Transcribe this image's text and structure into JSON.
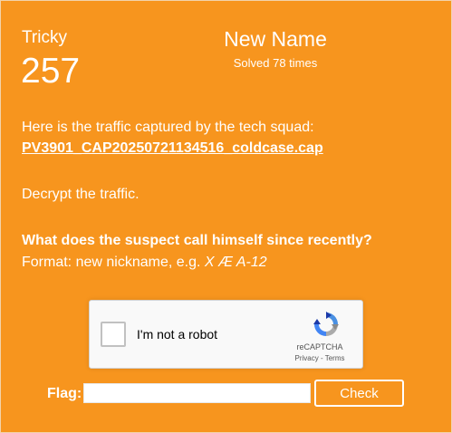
{
  "challenge": {
    "difficulty": "Tricky",
    "points": "257",
    "title": "New Name",
    "solves": "Solved 78 times"
  },
  "description": {
    "intro": "Here is the traffic captured by the tech squad:",
    "file_name": "PV3901_CAP20250721134516_coldcase.cap",
    "task": "Decrypt the traffic.",
    "question": "What does the suspect call himself since recently?",
    "format_prefix": "Format: new nickname, e.g. ",
    "format_example": "X Æ A-12"
  },
  "recaptcha": {
    "label": "I'm not a robot",
    "brand": "reCAPTCHA",
    "privacy": "Privacy",
    "separator": " - ",
    "terms": "Terms"
  },
  "flag_form": {
    "label": "Flag:",
    "value": "",
    "button_label": "Check"
  },
  "colors": {
    "background": "#F7951E",
    "text": "#FFFFFF"
  }
}
